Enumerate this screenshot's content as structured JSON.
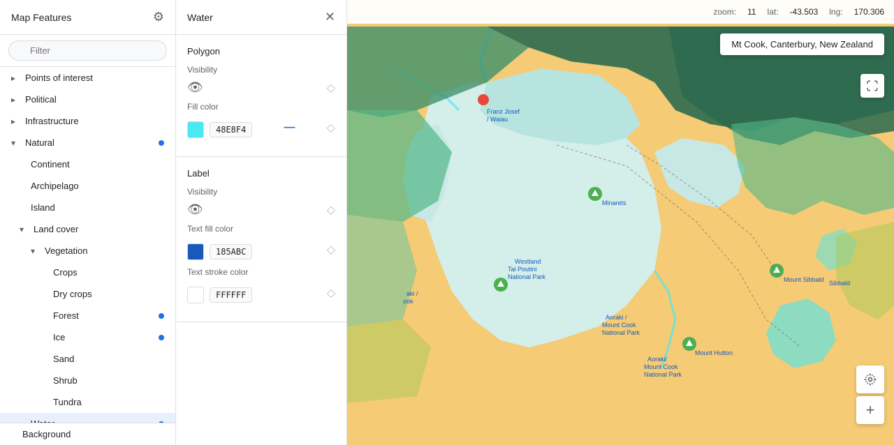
{
  "sidebar": {
    "title": "Map Features",
    "filter_placeholder": "Filter",
    "items": [
      {
        "id": "points-of-interest",
        "label": "Points of interest",
        "level": 0,
        "has_chevron": true,
        "chevron": "›",
        "dot": false
      },
      {
        "id": "political",
        "label": "Political",
        "level": 0,
        "has_chevron": true,
        "chevron": "›",
        "dot": false
      },
      {
        "id": "infrastructure",
        "label": "Infrastructure",
        "level": 0,
        "has_chevron": true,
        "chevron": "›",
        "dot": false
      },
      {
        "id": "natural",
        "label": "Natural",
        "level": 0,
        "has_chevron": true,
        "chevron": "∨",
        "dot": true
      },
      {
        "id": "continent",
        "label": "Continent",
        "level": 1,
        "has_chevron": false,
        "dot": false
      },
      {
        "id": "archipelago",
        "label": "Archipelago",
        "level": 1,
        "has_chevron": false,
        "dot": false
      },
      {
        "id": "island",
        "label": "Island",
        "level": 1,
        "has_chevron": false,
        "dot": false
      },
      {
        "id": "land-cover",
        "label": "Land cover",
        "level": 1,
        "has_chevron": true,
        "chevron": "∨",
        "dot": false
      },
      {
        "id": "vegetation",
        "label": "Vegetation",
        "level": 2,
        "has_chevron": true,
        "chevron": "∨",
        "dot": false
      },
      {
        "id": "crops",
        "label": "Crops",
        "level": 3,
        "has_chevron": false,
        "dot": false
      },
      {
        "id": "dry-crops",
        "label": "Dry crops",
        "level": 3,
        "has_chevron": false,
        "dot": false
      },
      {
        "id": "forest",
        "label": "Forest",
        "level": 3,
        "has_chevron": false,
        "dot": true
      },
      {
        "id": "ice",
        "label": "Ice",
        "level": 3,
        "has_chevron": false,
        "dot": true
      },
      {
        "id": "sand",
        "label": "Sand",
        "level": 3,
        "has_chevron": false,
        "dot": false
      },
      {
        "id": "shrub",
        "label": "Shrub",
        "level": 3,
        "has_chevron": false,
        "dot": false
      },
      {
        "id": "tundra",
        "label": "Tundra",
        "level": 3,
        "has_chevron": false,
        "dot": false
      },
      {
        "id": "water",
        "label": "Water",
        "level": 1,
        "has_chevron": false,
        "dot": true,
        "selected": true
      },
      {
        "id": "background",
        "label": "Background",
        "level": 0,
        "has_chevron": false,
        "dot": false,
        "bottom": true
      }
    ]
  },
  "panel": {
    "title": "Water",
    "polygon_section": {
      "title": "Polygon",
      "visibility_label": "Visibility",
      "fill_color_label": "Fill color",
      "fill_color_value": "48E8F4",
      "fill_color_hex": "#48E8F4"
    },
    "label_section": {
      "title": "Label",
      "visibility_label": "Visibility",
      "text_fill_color_label": "Text fill color",
      "text_fill_color_value": "185ABC",
      "text_fill_color_hex": "#185ABC",
      "text_stroke_color_label": "Text stroke color",
      "text_stroke_color_value": "FFFFFF",
      "text_stroke_color_hex": "#FFFFFF"
    }
  },
  "map": {
    "zoom_label": "zoom:",
    "zoom_value": "11",
    "lat_label": "lat:",
    "lat_value": "-43.503",
    "lng_label": "lng:",
    "lng_value": "170.306",
    "location_tooltip": "Mt Cook, Canterbury, New Zealand"
  }
}
